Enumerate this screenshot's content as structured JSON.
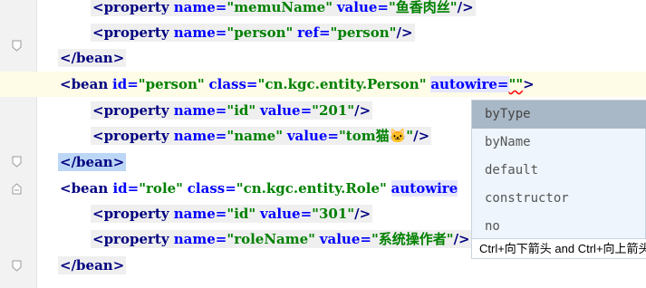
{
  "editor": {
    "lines": [
      {
        "indent": "    ",
        "parts": [
          [
            "<property ",
            "tag"
          ],
          [
            "name=",
            "attr"
          ],
          [
            "\"memuName\"",
            "val"
          ],
          [
            " ",
            "plain"
          ],
          [
            "value=",
            "attr"
          ],
          [
            "\"鱼香肉丝\"",
            "val"
          ],
          [
            "/>",
            "tag"
          ]
        ]
      },
      {
        "indent": "    ",
        "parts": [
          [
            "<property ",
            "tag"
          ],
          [
            "name=",
            "attr"
          ],
          [
            "\"person\"",
            "val"
          ],
          [
            " ",
            "plain"
          ],
          [
            "ref=",
            "attr"
          ],
          [
            "\"person\"",
            "val"
          ],
          [
            "/>",
            "tag"
          ]
        ]
      },
      {
        "indent": "",
        "parts": [
          [
            "</bean>",
            "tag"
          ]
        ]
      },
      {
        "indent": "",
        "parts": [
          [
            "<bean",
            "tag"
          ],
          [
            " ",
            "plain"
          ],
          [
            "id=",
            "attr"
          ],
          [
            "\"person\"",
            "val"
          ],
          [
            " ",
            "plain"
          ],
          [
            "class=",
            "attr"
          ],
          [
            "\"cn.kgc.entity.Person\"",
            "val"
          ],
          [
            " ",
            "plain"
          ],
          [
            "autowire=",
            "attr"
          ],
          [
            "\"\"",
            "val"
          ],
          [
            ">",
            "tag"
          ]
        ]
      },
      {
        "indent": "    ",
        "parts": [
          [
            "<property ",
            "tag"
          ],
          [
            "name=",
            "attr"
          ],
          [
            "\"id\"",
            "val"
          ],
          [
            " ",
            "plain"
          ],
          [
            "value=",
            "attr"
          ],
          [
            "\"201\"",
            "val"
          ],
          [
            "/>",
            "tag"
          ]
        ]
      },
      {
        "indent": "    ",
        "parts": [
          [
            "<property ",
            "tag"
          ],
          [
            "name=",
            "attr"
          ],
          [
            "\"name\"",
            "val"
          ],
          [
            " ",
            "plain"
          ],
          [
            "value=",
            "attr"
          ],
          [
            "\"tom猫🐱\"",
            "val"
          ],
          [
            "/>",
            "tag"
          ]
        ]
      },
      {
        "indent": "",
        "parts": [
          [
            "</bean>",
            "tag"
          ]
        ]
      },
      {
        "indent": "",
        "parts": [
          [
            "<bean ",
            "tag"
          ],
          [
            "id=",
            "attr"
          ],
          [
            "\"role\"",
            "val"
          ],
          [
            " ",
            "plain"
          ],
          [
            "class=",
            "attr"
          ],
          [
            "\"cn.kgc.entity.Role\"",
            "val"
          ],
          [
            " ",
            "plain"
          ],
          [
            "autowire",
            "attr"
          ]
        ]
      },
      {
        "indent": "    ",
        "parts": [
          [
            "<property ",
            "tag"
          ],
          [
            "name=",
            "attr"
          ],
          [
            "\"id\"",
            "val"
          ],
          [
            " ",
            "plain"
          ],
          [
            "value=",
            "attr"
          ],
          [
            "\"301\"",
            "val"
          ],
          [
            "/>",
            "tag"
          ]
        ]
      },
      {
        "indent": "    ",
        "parts": [
          [
            "<property ",
            "tag"
          ],
          [
            "name=",
            "attr"
          ],
          [
            "\"roleName\"",
            "val"
          ],
          [
            " ",
            "plain"
          ],
          [
            "value=",
            "attr"
          ],
          [
            "\"系统操作者\"",
            "val"
          ],
          [
            "/>",
            "tag"
          ]
        ]
      },
      {
        "indent": "",
        "parts": [
          [
            "</bean>",
            "tag"
          ]
        ]
      }
    ]
  },
  "completion_popup": {
    "items": [
      "byType",
      "byName",
      "default",
      "constructor",
      "no"
    ],
    "selected_index": 0,
    "hint": "Ctrl+向下箭头 and Ctrl+向上箭头"
  }
}
